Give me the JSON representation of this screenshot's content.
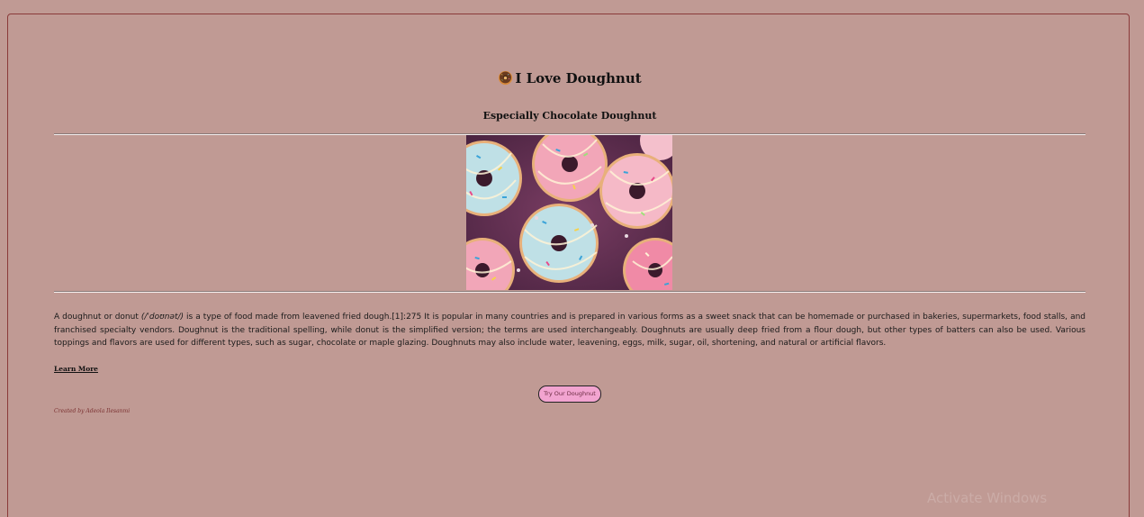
{
  "page": {
    "title": "I Love Doughnut",
    "subtitle": "Especially Chocolate Doughnut",
    "description": {
      "before_phonetic": "A doughnut or donut ",
      "phonetic": "(/ˈdoʊnət/)",
      "after_phonetic": " is a type of food made from leavened fried dough.[1]:275 It is popular in many countries and is prepared in various forms as a sweet snack that can be homemade or purchased in bakeries, supermarkets, food stalls, and franchised specialty vendors. Doughnut is the traditional spelling, while donut is the simplified version; the terms are used interchangeably. Doughnuts are usually deep fried from a flour dough, but other types of batters can also be used. Various toppings and flavors are used for different types, such as sugar, chocolate or maple glazing. Doughnuts may also include water, leavening, eggs, milk, sugar, oil, shortening, and natural or artificial flavors."
    },
    "learn_more_label": "Learn More",
    "cta_label": "Try Our Doughnut",
    "credit": "Created by Adeola Ilesanmi",
    "watermark": "Activate Windows"
  },
  "colors": {
    "background": "#c09a94",
    "frame_border": "#8a3a3a",
    "button_bg": "#f2a4d0",
    "credit_text": "#7a3030"
  },
  "icons": {
    "title_icon": "doughnut-icon"
  }
}
